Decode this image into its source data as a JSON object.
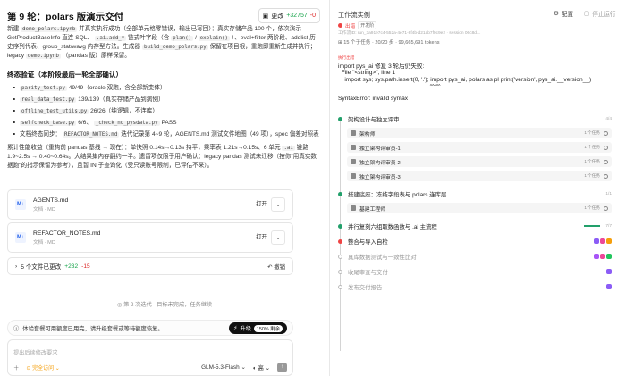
{
  "left": {
    "title": "第 9 轮：polars 版演示交付",
    "changes": {
      "icon": "file-diff-icon",
      "label": "更改",
      "added": "+32757",
      "removed": "-0"
    },
    "intro": {
      "p1": "新建",
      "nb": "demo_polars.ipynb",
      "p2": "并真实执行成功（全部单元格零错误，输出已写回）：真实存储产品 100 个，依次演示 GetProductBaseInfo 直连 SQL、",
      "c1": ".ai.add_*",
      "p3": "链式叶字段（含",
      "c2": "plan()",
      "p4": "/",
      "c3": "explain()",
      "p5": "）、eval+filter 两阶段、addlist 历史序列代表、group_stat/wavg 内存型方法。生成器",
      "c4": "build_demo_polars.py",
      "p6": "保留在项目根，重跑即重新生成并执行；legacy",
      "c5": "demo.ipynb",
      "p7": "（pandas 版）原样保留。"
    },
    "verify": {
      "heading": "终态验证（本阶段最后一轮全部确认）",
      "items": [
        {
          "code": "parity_test.py",
          "text": "49/49（oracle 双跑，含全部新变体）"
        },
        {
          "code": "real_data_test.py",
          "text": "139/139（真实存储产品到病例）"
        },
        {
          "code": "offline_test_utils.py",
          "text": "26/26（纯逻辑，不连库）"
        },
        {
          "code": "selfcheck_base.py",
          "text": "6/6、",
          "code2": "_check_no_pysdata.py",
          "text2": "PASS"
        },
        {
          "pre": "文档终态同步：",
          "code": "REFACTOR_NOTES.md",
          "text": "迭代记录第 4~9 轮，AGENTS.md 测试文件地图（49 项），spec 偏差对照表"
        }
      ]
    },
    "perf": {
      "p1": "累计性能收益（重构前 pandas 基线 → 现在）：单快照 0.14s→0.13s 持平，乘率表 1.21s→0.15s、6 单元",
      "c1": ".ai",
      "p2": "链路 1.9~2.5s → 0.40~0.64s。大结果集内存翻约一半。遗留项仅限于用户确认：legacy pandas 测试未迁移（按你\"用真实数据跑\"的指示保留为参考），且暂 IN 子查询化（受只读账号限制，已评估不采）。"
    },
    "files": [
      {
        "icon": "M↓",
        "name": "AGENTS.md",
        "type": "文档 · MD",
        "open": "打开"
      },
      {
        "icon": "M↓",
        "name": "REFACTOR_NOTES.md",
        "type": "文档 · MD",
        "open": "打开"
      }
    ],
    "changed": {
      "count_label": "5 个文件已更改",
      "added": "+232",
      "removed": "-15",
      "undo": "撤销"
    },
    "round_sep": "第 2 次迭代 · 目标未完成，任务继续",
    "notice": {
      "text": "体验套餐可用额度已用完，请升级套餐或等待额度恢复。",
      "upgrade": "升级",
      "pct": "150% 剩余"
    },
    "composer": {
      "placeholder": "提出后续修改要求",
      "access": "完全访问",
      "model": "GLM-5.3-Flash",
      "level": "高"
    }
  },
  "right": {
    "title": "工作流实例",
    "config": "配置",
    "stop": "停止运行",
    "status": "出错",
    "tag": "开发阶",
    "meta": "工作流ID: run_3a91e7c4-552a-4e71-8f4b-d21ab7f0c9e2 · session 06c8d…",
    "summary": "15 个子任务 · 20/20 步 · 99,665,691 tokens",
    "error": {
      "label": "执行出错",
      "lines": [
        "import pys_ai 修复 3 轮后仍失败:",
        "  File \"<string>\", line 1",
        "    import sys; sys.path.insert(0, '.'); import pys_ai, polars as pl print('version', pys_ai.__version__)",
        "                                                                          ^^^^^"
      ],
      "syntax": "SyntaxError: invalid syntax"
    },
    "stages": [
      {
        "name": "架构设计与独立评审",
        "count": "4/4",
        "color": "#22a06b"
      },
      {
        "name": "搭建底座：冻结字段表与 polars 连库层",
        "count": "1/1",
        "color": "#22a06b"
      },
      {
        "name": "并行复刻六组取数函数与 .ai 主流程",
        "count": "7/7",
        "color": "#22a06b"
      },
      {
        "name": "整合与导入自检",
        "count": "",
        "color": "#ef4444"
      },
      {
        "name": "真库数据测试与一致性比对",
        "count": "",
        "color": "#bbbbbb"
      },
      {
        "name": "收尾审查与交付",
        "count": "",
        "color": "#bbbbbb"
      },
      {
        "name": "发布交付报告",
        "count": "",
        "color": "#bbbbbb"
      }
    ],
    "tasks_stage1": [
      {
        "name": "架构师",
        "status": "1 个任务"
      },
      {
        "name": "独立架构评审员-1",
        "status": "1 个任务"
      },
      {
        "name": "独立架构评审员-2",
        "status": "1 个任务"
      },
      {
        "name": "独立架构评审员-3",
        "status": "1 个任务"
      }
    ],
    "tasks_stage2": [
      {
        "name": "基建工程师",
        "status": "1 个任务"
      }
    ]
  }
}
